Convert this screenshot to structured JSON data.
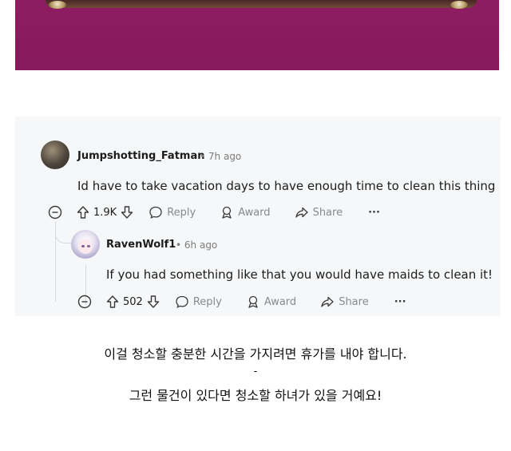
{
  "comment1": {
    "username": "Jumpshotting_Fatman",
    "time": "7h ago",
    "text": "Id have to take vacation days to have enough time to clean this thing",
    "votes": "1.9K",
    "reply_label": "Reply",
    "award_label": "Award",
    "share_label": "Share",
    "more_label": "···"
  },
  "comment2": {
    "username": "RavenWolf1",
    "time": "6h ago",
    "text": "If you had something like that you would have maids to clean it!",
    "votes": "502",
    "reply_label": "Reply",
    "award_label": "Award",
    "share_label": "Share",
    "more_label": "···"
  },
  "meta_separator": "•",
  "caption": {
    "line1": "이걸 청소할 충분한 시간을 가지려면 휴가를 내야 합니다.",
    "line2": "-",
    "line3": "그런 물건이 있다면 청소할 하녀가 있을 거예요!"
  },
  "colors": {
    "photo_bg": "#8a1a5e",
    "thread_bg": "#f6f7f8",
    "meta_gray": "#878a8c"
  }
}
